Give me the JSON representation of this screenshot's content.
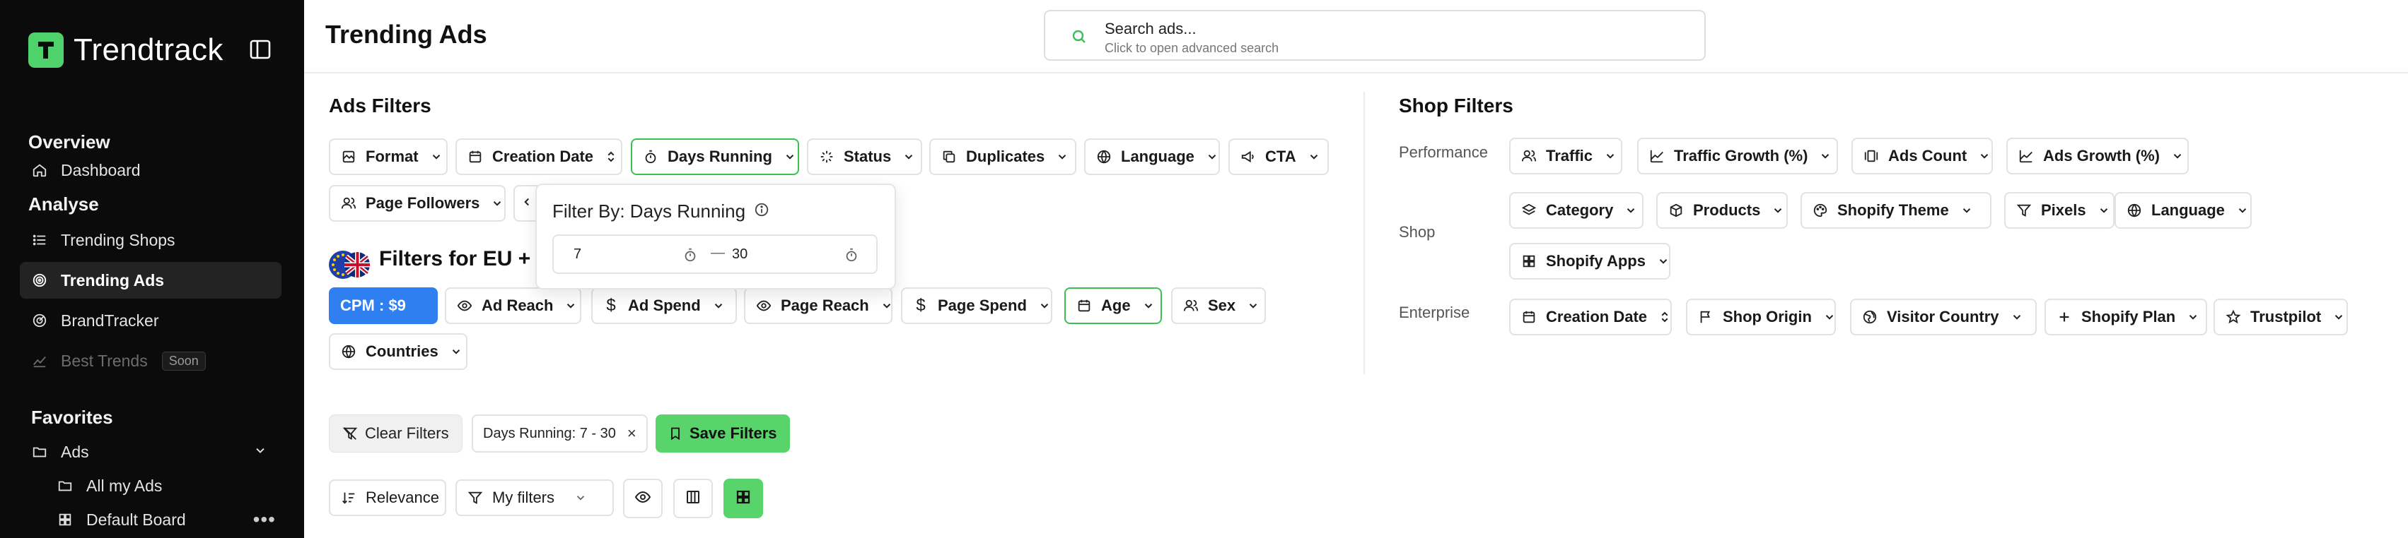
{
  "app": {
    "name": "Trendtrack"
  },
  "sidebar": {
    "overview_heading": "Overview",
    "analyse_heading": "Analyse",
    "favorites_heading": "Favorites",
    "items": {
      "dashboard": "Dashboard",
      "trending_shops": "Trending Shops",
      "trending_ads": "Trending Ads",
      "brandtracker": "BrandTracker",
      "best_trends": "Best Trends",
      "best_trends_badge": "Soon",
      "ads": "Ads",
      "all_my_ads": "All my Ads",
      "default_board": "Default Board"
    }
  },
  "header": {
    "title": "Trending Ads",
    "search_placeholder": "Search ads...",
    "search_hint": "Click to open advanced search"
  },
  "ads_filters": {
    "title": "Ads Filters",
    "chips": {
      "format": "Format",
      "creation_date": "Creation Date",
      "days_running": "Days Running",
      "status": "Status",
      "duplicates": "Duplicates",
      "language": "Language",
      "cta": "CTA",
      "page_followers": "Page Followers"
    },
    "popover": {
      "title": "Filter By: Days Running",
      "min": "7",
      "max": "30",
      "dash": "—"
    },
    "eu": {
      "title": "Filters for EU + U",
      "chips": {
        "cpm": "CPM : $9",
        "ad_reach": "Ad Reach",
        "ad_spend": "Ad Spend",
        "page_reach": "Page Reach",
        "page_spend": "Page Spend",
        "age": "Age",
        "sex": "Sex",
        "countries": "Countries"
      }
    }
  },
  "shop_filters": {
    "title": "Shop Filters",
    "labels": {
      "performance": "Performance",
      "shop": "Shop",
      "enterprise": "Enterprise"
    },
    "performance": {
      "traffic": "Traffic",
      "traffic_growth": "Traffic Growth (%)",
      "ads_count": "Ads Count",
      "ads_growth": "Ads Growth (%)"
    },
    "shop": {
      "category": "Category",
      "products": "Products",
      "shopify_theme": "Shopify Theme",
      "pixels": "Pixels",
      "language": "Language",
      "shopify_apps": "Shopify Apps"
    },
    "enterprise": {
      "creation_date": "Creation Date",
      "shop_origin": "Shop Origin",
      "visitor_country": "Visitor Country",
      "shopify_plan": "Shopify Plan",
      "trustpilot": "Trustpilot"
    }
  },
  "actions": {
    "clear_filters": "Clear Filters",
    "active_tag": "Days Running: 7 - 30",
    "active_tag_remove": "×",
    "save_filters": "Save Filters",
    "relevance": "Relevance",
    "my_filters": "My filters"
  },
  "colors": {
    "accent_green": "#58d46a",
    "cpm_blue": "#2f7ff0",
    "active_border": "#39c24f",
    "sidebar_bg": "#0b0b0b"
  }
}
